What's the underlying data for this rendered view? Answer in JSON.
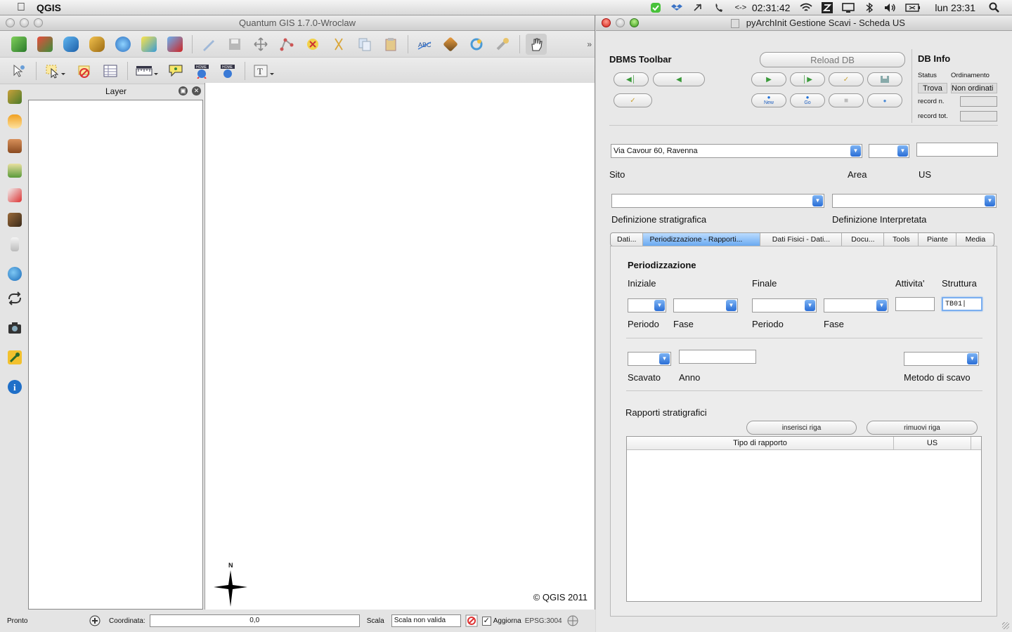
{
  "menubar": {
    "app_name": "QGIS",
    "clock_timer": "02:31:42",
    "datetime": "lun 23:31"
  },
  "qgis": {
    "window_title": "Quantum GIS 1.7.0-Wroclaw",
    "layer_panel_title": "Layer",
    "copyright": "© QGIS 2011",
    "north_label": "N",
    "status": {
      "ready": "Pronto",
      "coord_label": "Coordinata:",
      "coord_value": "0,0",
      "scale_label": "Scala",
      "scale_value": "Scala non valida",
      "update_label": "Aggiorna",
      "epsg": "EPSG:3004"
    }
  },
  "pyarch": {
    "window_title": "pyArchInit Gestione Scavi - Scheda US",
    "dbms_toolbar": "DBMS Toolbar",
    "reload_db": "Reload DB",
    "db_info": "DB Info",
    "status_label": "Status",
    "ordinamento_label": "Ordinamento",
    "status_value": "Trova",
    "ordinamento_value": "Non ordinati",
    "record_n_label": "record n.",
    "record_tot_label": "record tot.",
    "new_label": "New",
    "go_label": "Go",
    "sito_value": "Via Cavour 60, Ravenna",
    "sito_label": "Sito",
    "area_label": "Area",
    "us_label": "US",
    "def_strat_label": "Definizione stratigrafica",
    "def_interp_label": "Definizione Interpretata",
    "tabs": [
      "Dati...",
      "Periodizzazione - Rapporti...",
      "Dati Fisici - Dati...",
      "Docu...",
      "Tools",
      "Piante",
      "Media"
    ],
    "periodizzazione": {
      "title": "Periodizzazione",
      "iniziale": "Iniziale",
      "finale": "Finale",
      "attivita": "Attivita'",
      "struttura": "Struttura",
      "struttura_value": "TB01",
      "periodo1": "Periodo",
      "fase1": "Fase",
      "periodo2": "Periodo",
      "fase2": "Fase",
      "scavato": "Scavato",
      "anno": "Anno",
      "metodo": "Metodo di scavo",
      "rapporti_label": "Rapporti stratigrafici",
      "inserisci": "inserisci riga",
      "rimuovi": "rimuovi riga",
      "col_tipo": "Tipo di rapporto",
      "col_us": "US"
    }
  }
}
